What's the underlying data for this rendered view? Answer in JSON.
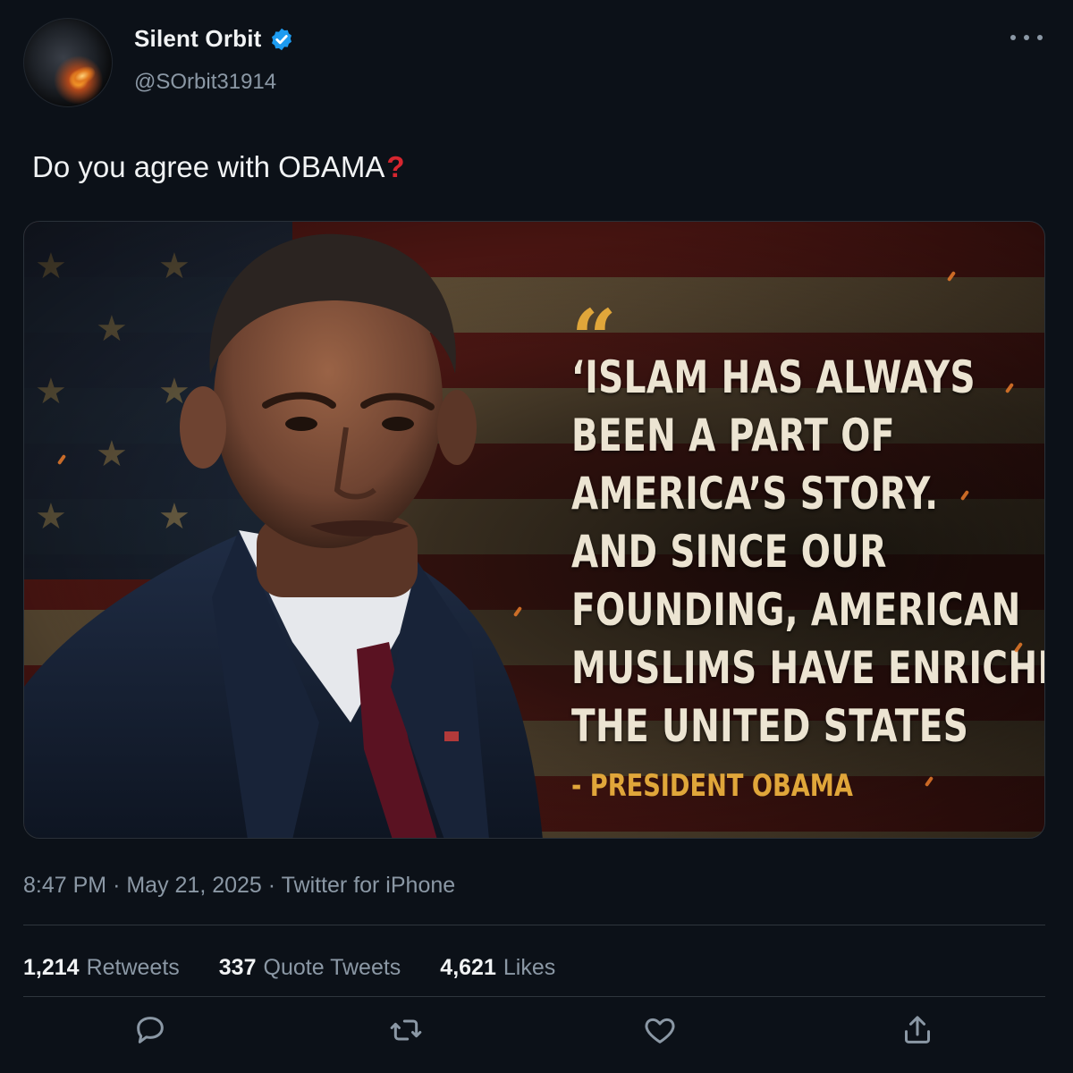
{
  "author": {
    "display_name": "Silent Orbit",
    "handle": "@SOrbit31914",
    "verified": true,
    "avatar_icon": "planet-explosion-avatar"
  },
  "tweet": {
    "text": "Do you agree with OBAMA",
    "emoji_icon": "red-question-mark"
  },
  "media": {
    "quote_lines": [
      "‘ISLAM HAS ALWAYS",
      "BEEN A PART OF",
      "AMERICA’S STORY.",
      "AND SINCE OUR",
      "FOUNDING, AMERICAN",
      "MUSLIMS HAVE ENRICHED",
      "THE UNITED STATES"
    ],
    "quote_mark": "“",
    "attribution": "- PRESIDENT OBAMA",
    "accent_color": "#e0a63a"
  },
  "meta": {
    "time": "8:47 PM",
    "date": "May 21, 2025",
    "source": "Twitter for iPhone"
  },
  "stats": {
    "retweets": "1,214",
    "retweets_label": "Retweets",
    "quote_tweets": "337",
    "quote_tweets_label": "Quote Tweets",
    "likes": "4,621",
    "likes_label": "Likes"
  },
  "actions": [
    "reply-icon",
    "retweet-icon",
    "like-icon",
    "share-icon"
  ],
  "colors": {
    "background": "#0c1118",
    "verified_blue": "#1d9bf0",
    "muted_text": "#8b98a5"
  }
}
